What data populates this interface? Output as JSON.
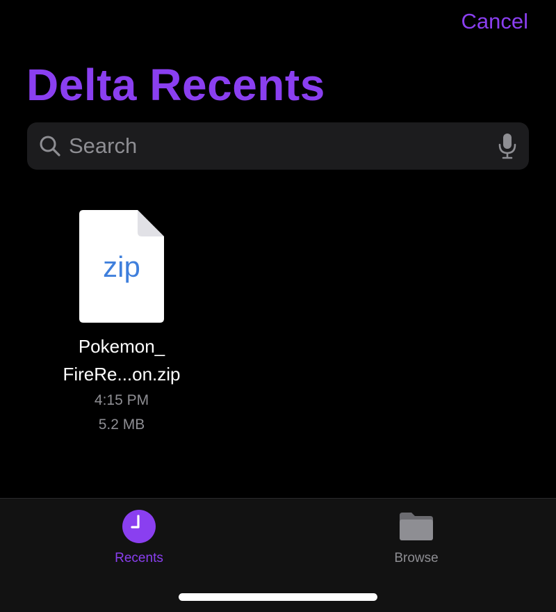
{
  "header": {
    "cancel_label": "Cancel",
    "title": "Delta Recents"
  },
  "search": {
    "placeholder": "Search",
    "value": ""
  },
  "files": [
    {
      "name_line1": "Pokemon_",
      "name_line2": "FireRe...on.zip",
      "type_label": "zip",
      "time": "4:15 PM",
      "size": "5.2 MB",
      "icon": "zip-file-icon"
    }
  ],
  "tabs": [
    {
      "label": "Recents",
      "icon": "clock-icon",
      "active": true
    },
    {
      "label": "Browse",
      "icon": "folder-icon",
      "active": false
    }
  ],
  "colors": {
    "accent": "#8a3ff0",
    "background": "#000000",
    "search_bg": "#1c1c1e",
    "secondary_text": "#8e8e93",
    "tab_bar_bg": "#121212",
    "zip_text": "#3f7fdc"
  }
}
